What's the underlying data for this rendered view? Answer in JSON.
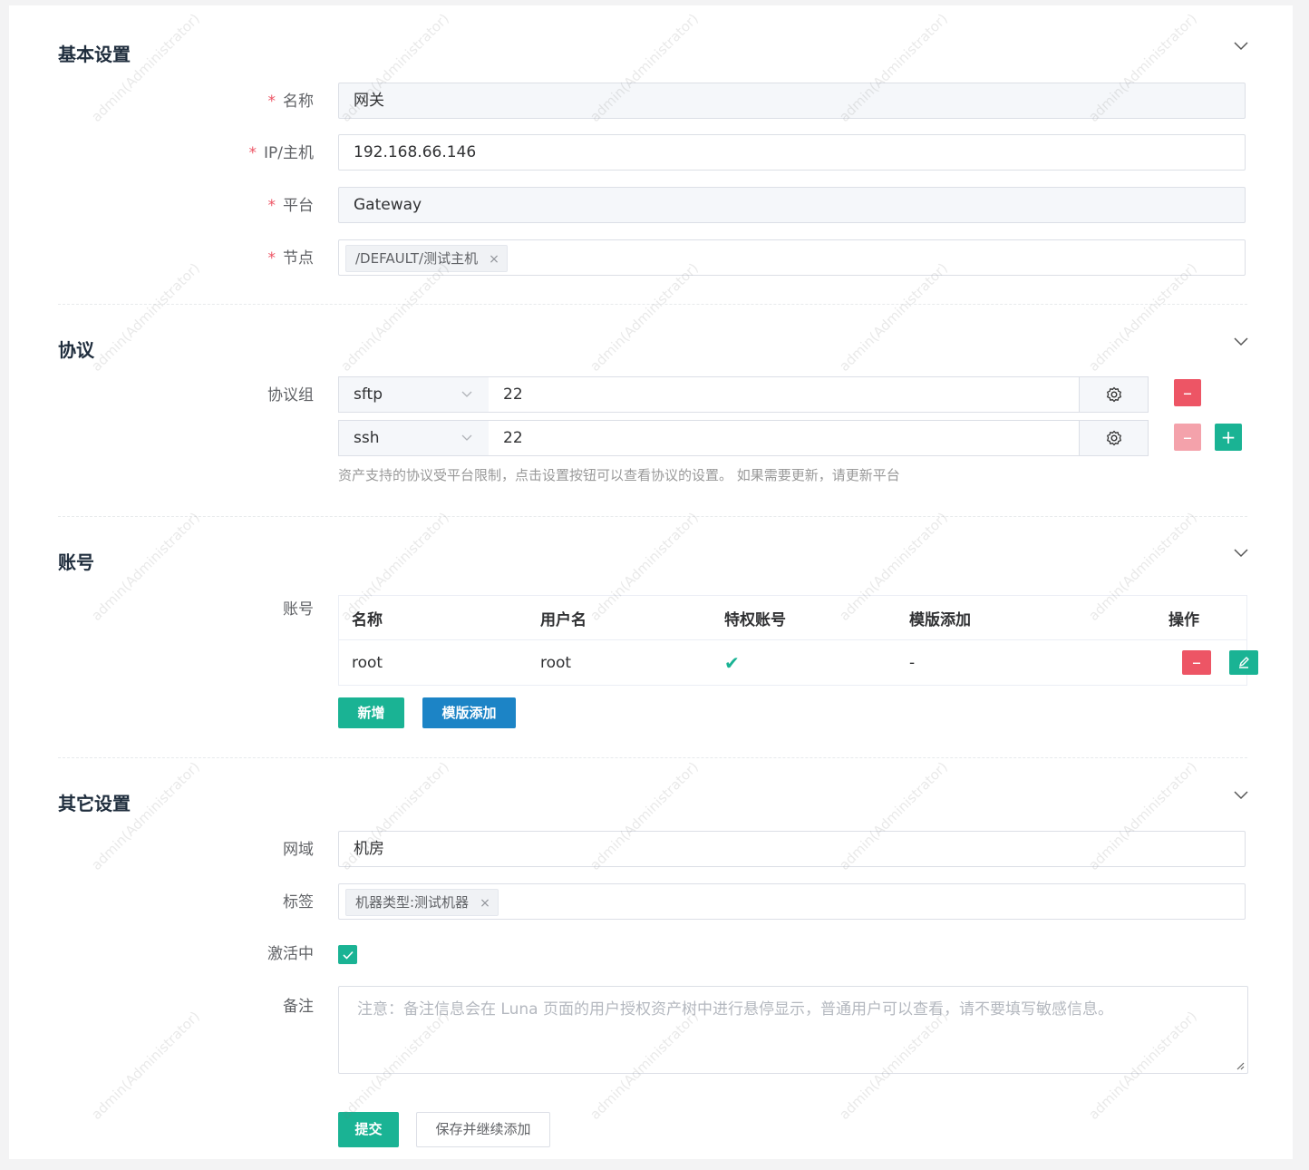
{
  "watermark": "admin(Administrator)",
  "basic": {
    "title": "基本设置",
    "name_label": "名称",
    "name_value": "网关",
    "ip_label": "IP/主机",
    "ip_value": "192.168.66.146",
    "platform_label": "平台",
    "platform_value": "Gateway",
    "node_label": "节点",
    "node_tag": "/DEFAULT/测试主机",
    "required_mark": "*",
    "tag_close": "×"
  },
  "protocol": {
    "title": "协议",
    "group_label": "协议组",
    "rows": [
      {
        "name": "sftp",
        "port": "22"
      },
      {
        "name": "ssh",
        "port": "22"
      }
    ],
    "help": "资产支持的协议受平台限制，点击设置按钮可以查看协议的设置。 如果需要更新，请更新平台",
    "minus": "–",
    "plus": "+"
  },
  "account": {
    "title": "账号",
    "label": "账号",
    "headers": [
      "名称",
      "用户名",
      "特权账号",
      "模版添加",
      "操作"
    ],
    "rows": [
      {
        "name": "root",
        "username": "root",
        "privileged": "✔",
        "template": "-"
      }
    ],
    "add_btn": "新增",
    "template_btn": "模版添加"
  },
  "other": {
    "title": "其它设置",
    "domain_label": "网域",
    "domain_value": "机房",
    "tags_label": "标签",
    "tag_value": "机器类型:测试机器",
    "active_label": "激活中",
    "comment_label": "备注",
    "comment_placeholder": "注意：备注信息会在 Luna 页面的用户授权资产树中进行悬停显示，普通用户可以查看，请不要填写敏感信息。"
  },
  "actions": {
    "submit": "提交",
    "save_continue": "保存并继续添加"
  },
  "colors": {
    "primary": "#1ab394",
    "danger": "#ed5565",
    "info": "#1c84c6"
  }
}
